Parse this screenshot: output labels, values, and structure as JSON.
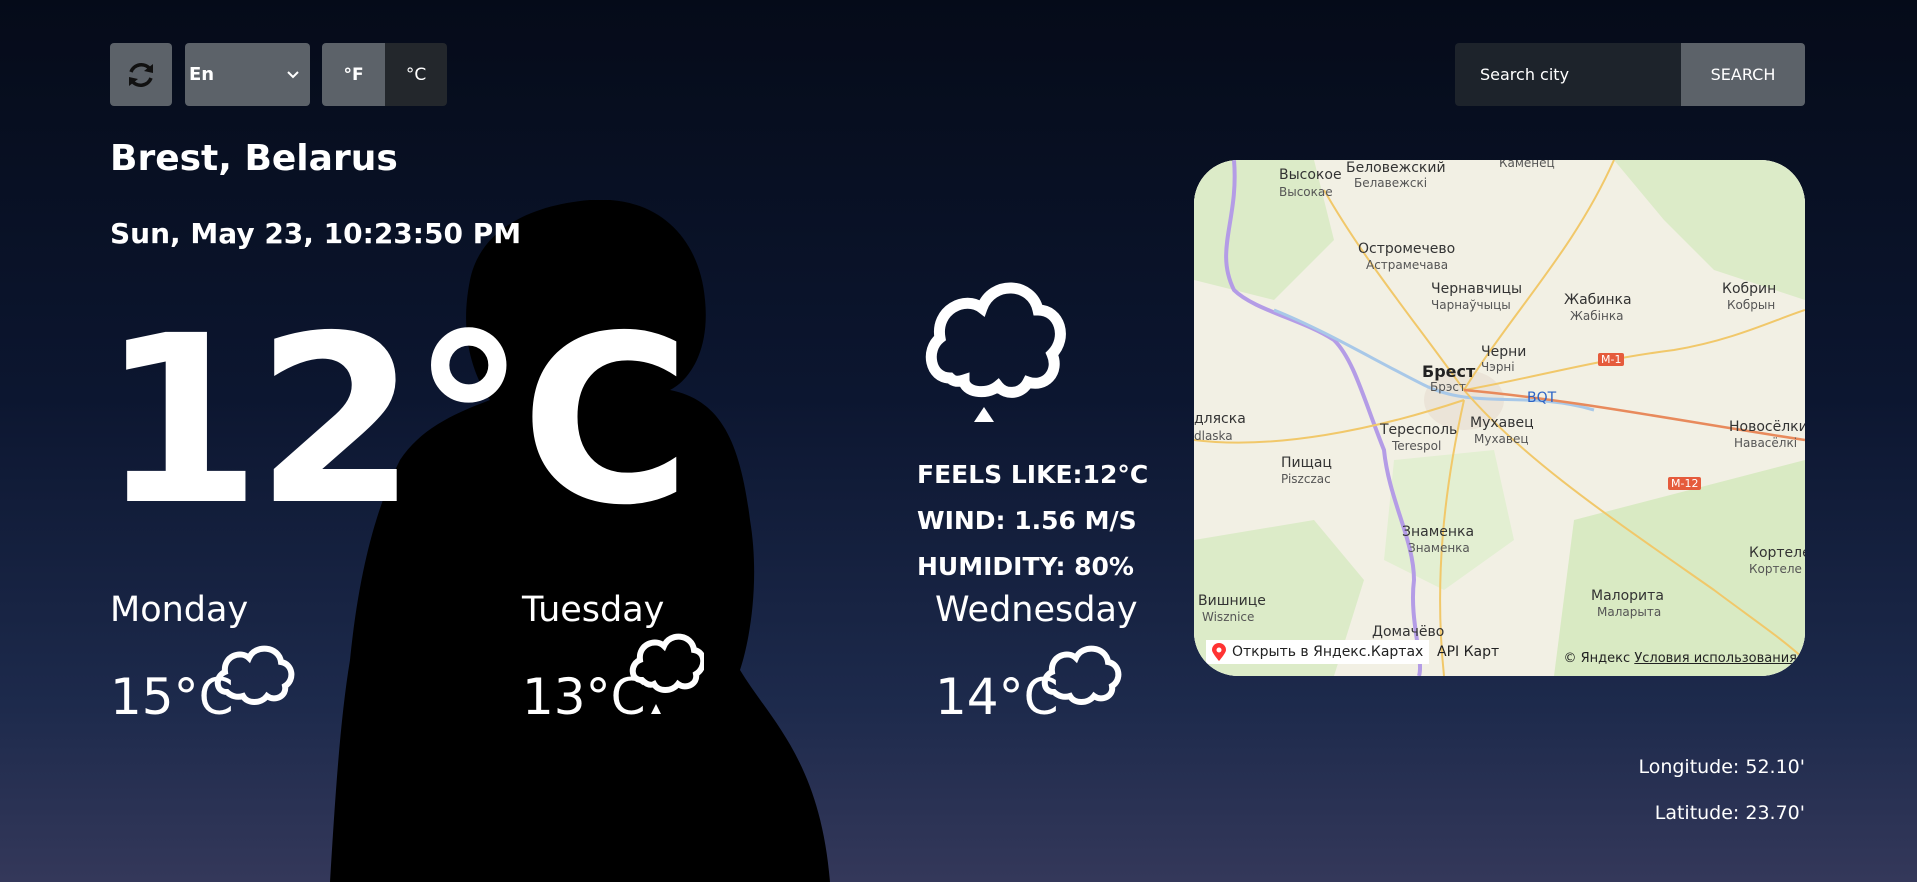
{
  "toolbar": {
    "language_selected": "En",
    "unit_f_label": "°F",
    "unit_c_label": "°C",
    "search_placeholder": "Search city",
    "search_button_label": "SEARCH"
  },
  "location": {
    "city": "Brest, Belarus",
    "datetime": "Sun, May 23, 10:23:50 PM"
  },
  "current": {
    "temperature": "12°C",
    "icon": "cloud-icon",
    "feels_like": "FEELS LIKE:12°C",
    "wind": "WIND: 1.56 M/S",
    "humidity": "HUMIDITY: 80%"
  },
  "forecast": [
    {
      "day": "Monday",
      "temp": "15°C",
      "icon": "cloud-icon"
    },
    {
      "day": "Tuesday",
      "temp": "13°C",
      "icon": "cloud-icon"
    },
    {
      "day": "Wednesday",
      "temp": "14°C",
      "icon": "cloud-icon"
    }
  ],
  "map": {
    "labels": {
      "brest": "Брест",
      "brest_by": "Брэст",
      "vysokoe": "Высокое",
      "vysokoe_by": "Высокае",
      "belovezhsky": "Беловежский",
      "belovezhsky_by": "Белавежскі",
      "kamenets": "Каменец",
      "ostromechevo": "Остромечево",
      "ostromechevo_by": "Астрамечава",
      "chernavchitsy": "Чернавчицы",
      "chernavchitsy_by": "Чарнаўчыцы",
      "zhabinka": "Жабинка",
      "zhabinka_by": "Жабінка",
      "kobrin": "Кобрин",
      "kobrin_by": "Кобрын",
      "cherni": "Черни",
      "cherni_by": "Чэрні",
      "m1": "M-1",
      "bqt": "BQT",
      "mukhavets_big": "Мухавец",
      "mukhavets_big_by": "Мухавец",
      "terespol": "Тересполь",
      "terespol_pl": "Terespol",
      "biala": "дляска",
      "biala_pl": "dlaska",
      "novoselki": "Новосёлки",
      "novoselki_by": "Навасёлкі",
      "pishchats": "Пищац",
      "pishchats_pl": "Piszczac",
      "m12": "M-12",
      "znamenka": "Знаменка",
      "znamenka_by": "Знаменка",
      "kortelesy": "Кортеле",
      "kortelesy_by": "Кортеле",
      "vishnitse": "Вишнице",
      "vishnitse_pl": "Wisznice",
      "malorita": "Малорита",
      "malorita_by": "Маларыта",
      "domachevo": "Домачёво"
    },
    "open_link": "Открыть в Яндекс.Картах",
    "api_link": "API Карт",
    "copyright": "© Яндекс",
    "terms_link": "Условия использования"
  },
  "coords": {
    "longitude": "Longitude: 52.10'",
    "latitude": "Latitude: 23.70'"
  }
}
